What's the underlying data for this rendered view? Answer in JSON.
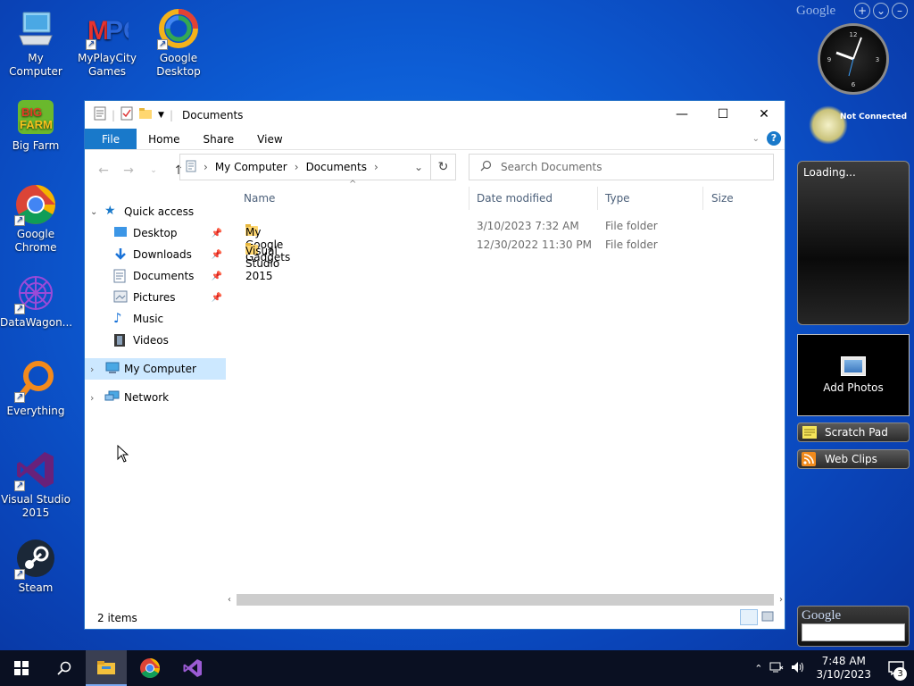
{
  "desktop": {
    "icons": [
      {
        "label": "My Computer"
      },
      {
        "label": "MyPlayCity Games"
      },
      {
        "label": "Google Desktop"
      },
      {
        "label": "Big Farm"
      },
      {
        "label": "Google Chrome"
      },
      {
        "label": "DataWagon..."
      },
      {
        "label": "Everything"
      },
      {
        "label": "Visual Studio 2015"
      },
      {
        "label": "Steam"
      }
    ]
  },
  "window": {
    "title": "Documents",
    "ribbon_tabs": [
      "File",
      "Home",
      "Share",
      "View"
    ],
    "breadcrumb": [
      "My Computer",
      "Documents"
    ],
    "search_placeholder": "Search Documents",
    "nav": {
      "quick_access": "Quick access",
      "items": [
        {
          "label": "Desktop",
          "pinned": true
        },
        {
          "label": "Downloads",
          "pinned": true
        },
        {
          "label": "Documents",
          "pinned": true
        },
        {
          "label": "Pictures",
          "pinned": true
        },
        {
          "label": "Music",
          "pinned": false
        },
        {
          "label": "Videos",
          "pinned": false
        }
      ],
      "my_computer": "My Computer",
      "network": "Network"
    },
    "columns": [
      "Name",
      "Date modified",
      "Type",
      "Size"
    ],
    "files": [
      {
        "name": "My Google Gadgets",
        "date": "3/10/2023 7:32 AM",
        "type": "File folder",
        "size": ""
      },
      {
        "name": "Visual Studio 2015",
        "date": "12/30/2022 11:30 PM",
        "type": "File folder",
        "size": ""
      }
    ],
    "status": "2 items"
  },
  "gadgets": {
    "google_logo": "Google",
    "weather_status": "Not Connected",
    "loading": "Loading...",
    "add_photos": "Add Photos",
    "scratch_pad": "Scratch Pad",
    "web_clips": "Web Clips",
    "search_logo": "Google"
  },
  "taskbar": {
    "time": "7:48 AM",
    "date": "3/10/2023",
    "notification_count": "3"
  },
  "colors": {
    "accent": "#1979ca",
    "desktop": "#0d5ed6",
    "selection": "#cce8ff"
  }
}
